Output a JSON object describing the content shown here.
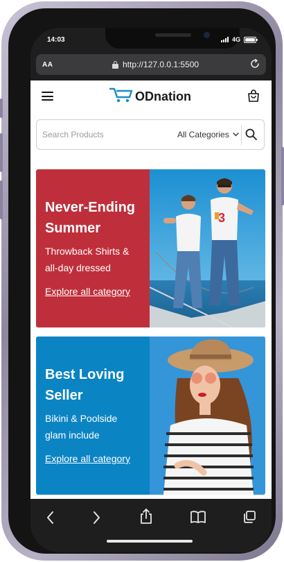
{
  "status": {
    "time": "14:03",
    "network": "4G"
  },
  "browser": {
    "text_size_label": "AA",
    "url": "http://127.0.0.1:5500"
  },
  "header": {
    "logo_text": "ODnation"
  },
  "search": {
    "placeholder": "Search Products",
    "category": "All Categories"
  },
  "banners": [
    {
      "title_line1": "Never-Ending",
      "title_line2": "Summer",
      "subtitle_line1": "Throwback Shirts &",
      "subtitle_line2": "all-day dressed",
      "link": "Explore all category",
      "bg_color": "#bf2f3b"
    },
    {
      "title_line1": "Best Loving",
      "title_line2": "Seller",
      "subtitle_line1": "Bikini & Poolside",
      "subtitle_line2": "glam include",
      "link": "Explore all category",
      "bg_color": "#0b84c4"
    }
  ],
  "icons": {
    "menu": "hamburger-icon",
    "logo": "cart-logo-icon",
    "bag": "shopping-bag-icon",
    "search": "search-icon",
    "dropdown": "chevron-down-icon",
    "lock": "lock-icon",
    "reload": "reload-icon",
    "back": "back-arrow-icon",
    "forward": "forward-arrow-icon",
    "share": "share-icon",
    "bookmarks": "bookmarks-icon",
    "tabs": "tabs-icon"
  },
  "colors": {
    "accent": "#1a8ad0",
    "banner_red": "#bf2f3b",
    "banner_blue": "#0b84c4"
  }
}
